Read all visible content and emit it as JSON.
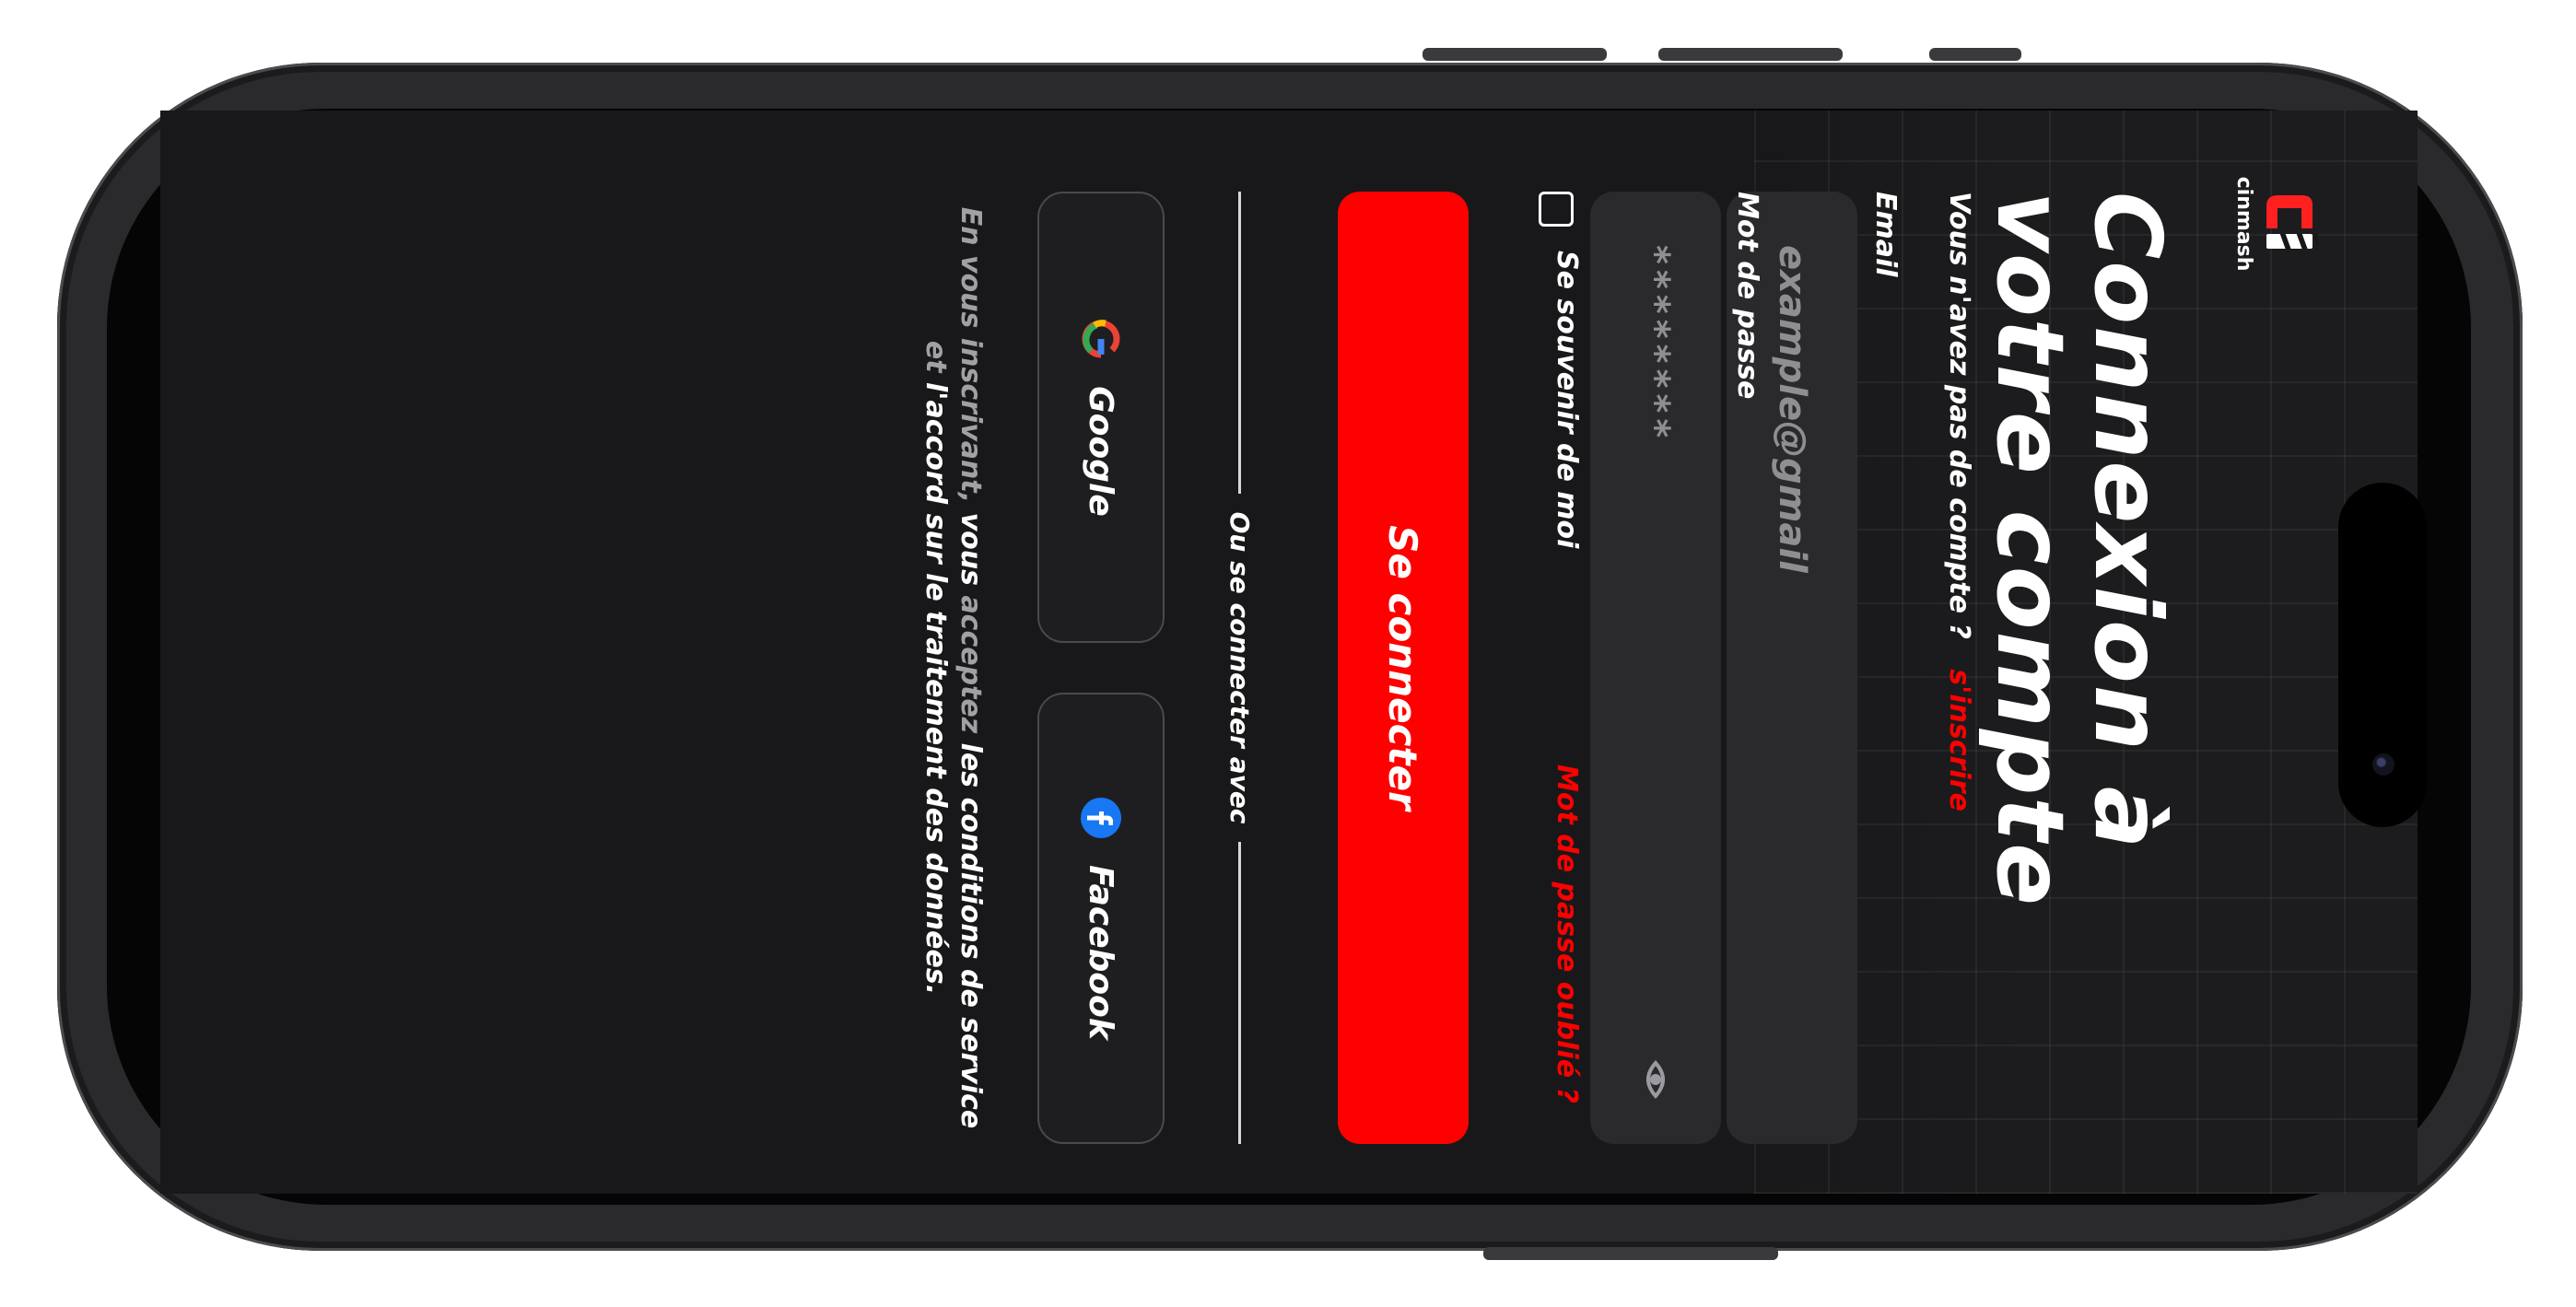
{
  "app": {
    "logo_text": "cinmash",
    "brand_color": "#ff0000"
  },
  "login": {
    "title": "Connexion à votre compte",
    "no_account_text": "Vous n'avez pas de compte ?",
    "signup_link": "s'inscrire",
    "email_label": "Email",
    "email_placeholder": "example@gmail",
    "password_label": "Mot de passe",
    "password_placeholder": "********",
    "password_toggle_icon": "eye-icon",
    "remember_label": "Se souvenir de moi",
    "forgot_link": "Mot de passe oublié ?",
    "submit_label": "Se connecter",
    "divider_text": "Ou se connecter avec",
    "google_label": "Google",
    "facebook_label": "Facebook"
  },
  "terms": {
    "t1": "En vous",
    "t2": "inscrivant,",
    "t3": "vous",
    "t4": "acceptez",
    "t5": "les conditions de service",
    "t6": "et",
    "t7": "l'accord sur le traitement des données."
  }
}
